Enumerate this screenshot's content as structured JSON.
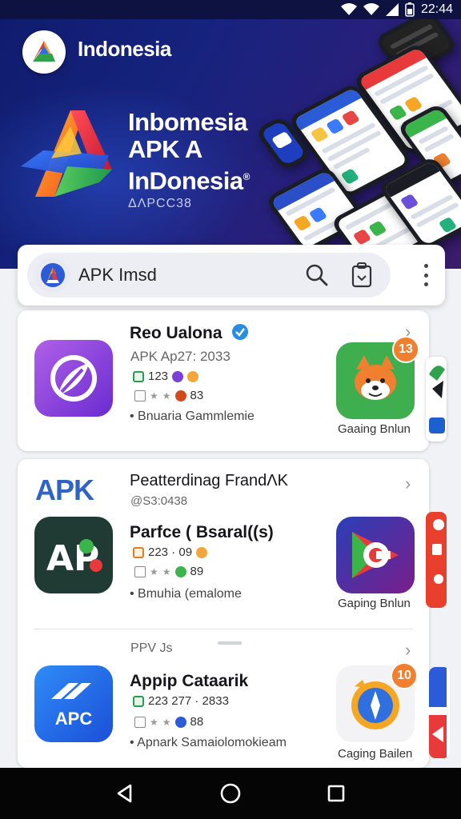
{
  "status_bar": {
    "time": "22:44"
  },
  "hero": {
    "brand_name": "Indonesia",
    "brand_tagline": "",
    "title_lines": [
      "Inbomesia",
      "APK A",
      "InDonesia"
    ],
    "trademark": "®",
    "subtitle": "ΔΛΡCC38"
  },
  "search": {
    "text": "APK Imsd"
  },
  "apps": [
    {
      "title": "Reo Ualona",
      "verified": true,
      "meta": "APK Ap27:  2033",
      "stats1": "123",
      "stats2": "83",
      "bullet": "• Bnuaria Gammlemie",
      "side_label": "Gaaing Bnlun",
      "side_badge": "13"
    },
    {
      "section_logo": "APK",
      "section_title": "Peatterdinag FrandΛK",
      "section_sub": "@S3:0438",
      "title": "Parfce ( Bsaral((s)",
      "stats1": "223 · 09",
      "stats2": "89",
      "bullet": "• Bmuhia (emalome",
      "side_label": "Gaping Bnlun"
    },
    {
      "section_title": "PPV Js",
      "title": "Appip Cataarik",
      "stats1": "223 277 · 2833",
      "stats2": "88",
      "bullet": "• Apnark Samaiolomokieam",
      "icon_text": "APC",
      "side_label": "Caging Bailen",
      "side_badge": "10"
    }
  ],
  "colors": {
    "hero_bg": "#16237e",
    "accent_orange": "#f08030",
    "verified_blue": "#2b8de0"
  }
}
